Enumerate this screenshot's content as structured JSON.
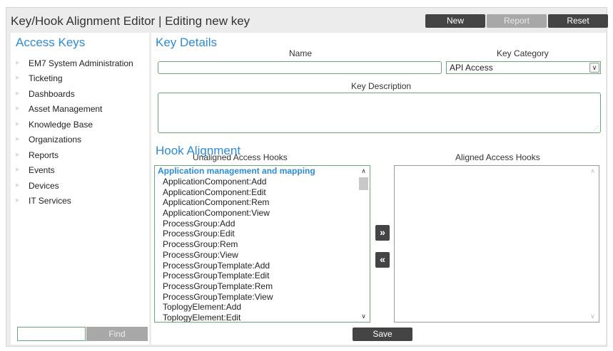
{
  "header": {
    "title": "Key/Hook Alignment Editor | Editing new key",
    "new_label": "New",
    "report_label": "Report",
    "reset_label": "Reset"
  },
  "sidebar": {
    "heading": "Access Keys",
    "items": [
      {
        "label": "EM7 System Administration"
      },
      {
        "label": "Ticketing"
      },
      {
        "label": "Dashboards"
      },
      {
        "label": "Asset Management"
      },
      {
        "label": "Knowledge Base"
      },
      {
        "label": "Organizations"
      },
      {
        "label": "Reports"
      },
      {
        "label": "Events"
      },
      {
        "label": "Devices"
      },
      {
        "label": "IT Services"
      }
    ],
    "find_value": "",
    "find_label": "Find"
  },
  "key_details": {
    "heading": "Key Details",
    "name_label": "Name",
    "name_value": "",
    "category_label": "Key Category",
    "category_value": "API Access",
    "description_label": "Key Description",
    "description_value": ""
  },
  "hook_alignment": {
    "heading": "Hook Alignment",
    "unaligned_label": "Unaligned Access Hooks",
    "aligned_label": "Aligned Access Hooks",
    "group": "Application management and mapping",
    "unaligned_items": [
      "ApplicationComponent:Add",
      "ApplicationComponent:Edit",
      "ApplicationComponent:Rem",
      "ApplicationComponent:View",
      "ProcessGroup:Add",
      "ProcessGroup:Edit",
      "ProcessGroup:Rem",
      "ProcessGroup:View",
      "ProcessGroupTemplate:Add",
      "ProcessGroupTemplate:Edit",
      "ProcessGroupTemplate:Rem",
      "ProcessGroupTemplate:View",
      "ToplogyElement:Add",
      "ToplogyElement:Edit"
    ],
    "move_right_label": "»",
    "move_left_label": "«",
    "save_label": "Save"
  },
  "colors": {
    "accent": "#2e8bd6",
    "dark_button": "#444444",
    "disabled_button": "#a8a8a8",
    "field_border": "#6aa87a"
  },
  "icons": {
    "nav_arrow": "triangle-right-icon",
    "select_chevron": "chevron-down-icon",
    "scroll_up": "chevron-up-icon",
    "scroll_down": "chevron-down-icon"
  }
}
